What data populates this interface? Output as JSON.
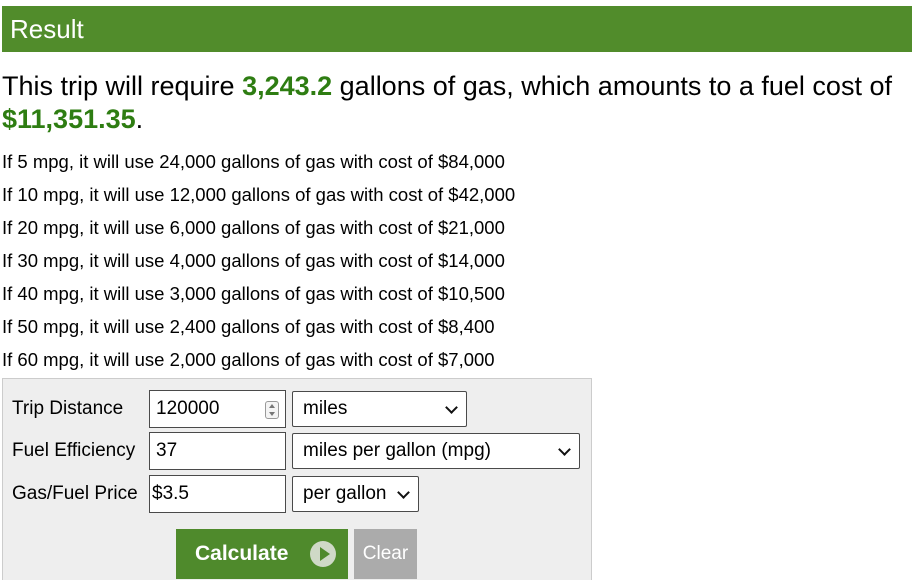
{
  "header": {
    "title": "Result"
  },
  "summary": {
    "prefix": "This trip will require ",
    "gallons": "3,243.2",
    "middle": " gallons of gas, which amounts to a fuel cost of ",
    "cost": "$11,351.35",
    "suffix": "."
  },
  "scenarios": [
    "If 5 mpg, it will use 24,000 gallons of gas with cost of $84,000",
    "If 10 mpg, it will use 12,000 gallons of gas with cost of $42,000",
    "If 20 mpg, it will use 6,000 gallons of gas with cost of $21,000",
    "If 30 mpg, it will use 4,000 gallons of gas with cost of $14,000",
    "If 40 mpg, it will use 3,000 gallons of gas with cost of $10,500",
    "If 50 mpg, it will use 2,400 gallons of gas with cost of $8,400",
    "If 60 mpg, it will use 2,000 gallons of gas with cost of $7,000"
  ],
  "form": {
    "trip_distance": {
      "label": "Trip Distance",
      "value": "120000",
      "unit": "miles"
    },
    "fuel_efficiency": {
      "label": "Fuel Efficiency",
      "value": "37",
      "unit": "miles per gallon (mpg)"
    },
    "gas_price": {
      "label": "Gas/Fuel Price",
      "value": "$3.5",
      "unit": "per gallon"
    },
    "calculate_label": "Calculate",
    "clear_label": "Clear"
  }
}
